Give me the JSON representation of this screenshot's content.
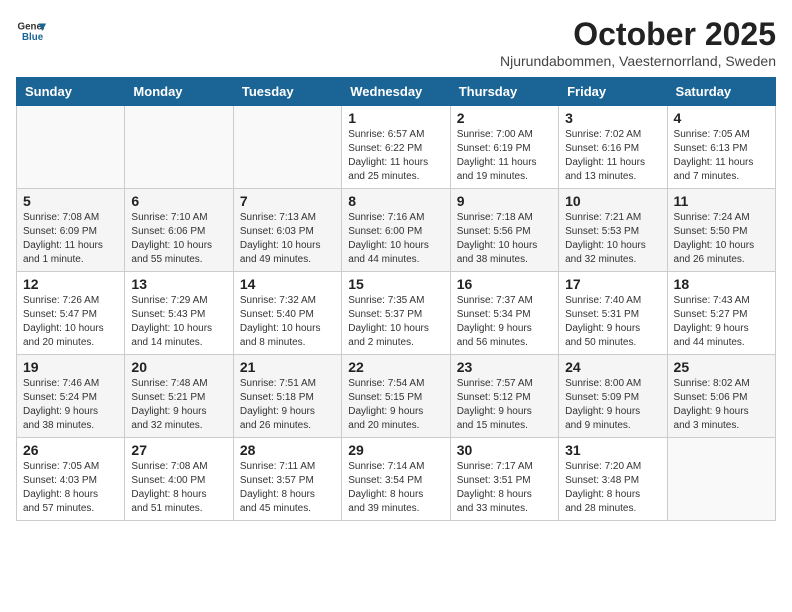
{
  "header": {
    "logo_line1": "General",
    "logo_line2": "Blue",
    "month_year": "October 2025",
    "location": "Njurundabommen, Vaesternorrland, Sweden"
  },
  "weekdays": [
    "Sunday",
    "Monday",
    "Tuesday",
    "Wednesday",
    "Thursday",
    "Friday",
    "Saturday"
  ],
  "weeks": [
    [
      {
        "day": "",
        "info": ""
      },
      {
        "day": "",
        "info": ""
      },
      {
        "day": "",
        "info": ""
      },
      {
        "day": "1",
        "info": "Sunrise: 6:57 AM\nSunset: 6:22 PM\nDaylight: 11 hours\nand 25 minutes."
      },
      {
        "day": "2",
        "info": "Sunrise: 7:00 AM\nSunset: 6:19 PM\nDaylight: 11 hours\nand 19 minutes."
      },
      {
        "day": "3",
        "info": "Sunrise: 7:02 AM\nSunset: 6:16 PM\nDaylight: 11 hours\nand 13 minutes."
      },
      {
        "day": "4",
        "info": "Sunrise: 7:05 AM\nSunset: 6:13 PM\nDaylight: 11 hours\nand 7 minutes."
      }
    ],
    [
      {
        "day": "5",
        "info": "Sunrise: 7:08 AM\nSunset: 6:09 PM\nDaylight: 11 hours\nand 1 minute."
      },
      {
        "day": "6",
        "info": "Sunrise: 7:10 AM\nSunset: 6:06 PM\nDaylight: 10 hours\nand 55 minutes."
      },
      {
        "day": "7",
        "info": "Sunrise: 7:13 AM\nSunset: 6:03 PM\nDaylight: 10 hours\nand 49 minutes."
      },
      {
        "day": "8",
        "info": "Sunrise: 7:16 AM\nSunset: 6:00 PM\nDaylight: 10 hours\nand 44 minutes."
      },
      {
        "day": "9",
        "info": "Sunrise: 7:18 AM\nSunset: 5:56 PM\nDaylight: 10 hours\nand 38 minutes."
      },
      {
        "day": "10",
        "info": "Sunrise: 7:21 AM\nSunset: 5:53 PM\nDaylight: 10 hours\nand 32 minutes."
      },
      {
        "day": "11",
        "info": "Sunrise: 7:24 AM\nSunset: 5:50 PM\nDaylight: 10 hours\nand 26 minutes."
      }
    ],
    [
      {
        "day": "12",
        "info": "Sunrise: 7:26 AM\nSunset: 5:47 PM\nDaylight: 10 hours\nand 20 minutes."
      },
      {
        "day": "13",
        "info": "Sunrise: 7:29 AM\nSunset: 5:43 PM\nDaylight: 10 hours\nand 14 minutes."
      },
      {
        "day": "14",
        "info": "Sunrise: 7:32 AM\nSunset: 5:40 PM\nDaylight: 10 hours\nand 8 minutes."
      },
      {
        "day": "15",
        "info": "Sunrise: 7:35 AM\nSunset: 5:37 PM\nDaylight: 10 hours\nand 2 minutes."
      },
      {
        "day": "16",
        "info": "Sunrise: 7:37 AM\nSunset: 5:34 PM\nDaylight: 9 hours\nand 56 minutes."
      },
      {
        "day": "17",
        "info": "Sunrise: 7:40 AM\nSunset: 5:31 PM\nDaylight: 9 hours\nand 50 minutes."
      },
      {
        "day": "18",
        "info": "Sunrise: 7:43 AM\nSunset: 5:27 PM\nDaylight: 9 hours\nand 44 minutes."
      }
    ],
    [
      {
        "day": "19",
        "info": "Sunrise: 7:46 AM\nSunset: 5:24 PM\nDaylight: 9 hours\nand 38 minutes."
      },
      {
        "day": "20",
        "info": "Sunrise: 7:48 AM\nSunset: 5:21 PM\nDaylight: 9 hours\nand 32 minutes."
      },
      {
        "day": "21",
        "info": "Sunrise: 7:51 AM\nSunset: 5:18 PM\nDaylight: 9 hours\nand 26 minutes."
      },
      {
        "day": "22",
        "info": "Sunrise: 7:54 AM\nSunset: 5:15 PM\nDaylight: 9 hours\nand 20 minutes."
      },
      {
        "day": "23",
        "info": "Sunrise: 7:57 AM\nSunset: 5:12 PM\nDaylight: 9 hours\nand 15 minutes."
      },
      {
        "day": "24",
        "info": "Sunrise: 8:00 AM\nSunset: 5:09 PM\nDaylight: 9 hours\nand 9 minutes."
      },
      {
        "day": "25",
        "info": "Sunrise: 8:02 AM\nSunset: 5:06 PM\nDaylight: 9 hours\nand 3 minutes."
      }
    ],
    [
      {
        "day": "26",
        "info": "Sunrise: 7:05 AM\nSunset: 4:03 PM\nDaylight: 8 hours\nand 57 minutes."
      },
      {
        "day": "27",
        "info": "Sunrise: 7:08 AM\nSunset: 4:00 PM\nDaylight: 8 hours\nand 51 minutes."
      },
      {
        "day": "28",
        "info": "Sunrise: 7:11 AM\nSunset: 3:57 PM\nDaylight: 8 hours\nand 45 minutes."
      },
      {
        "day": "29",
        "info": "Sunrise: 7:14 AM\nSunset: 3:54 PM\nDaylight: 8 hours\nand 39 minutes."
      },
      {
        "day": "30",
        "info": "Sunrise: 7:17 AM\nSunset: 3:51 PM\nDaylight: 8 hours\nand 33 minutes."
      },
      {
        "day": "31",
        "info": "Sunrise: 7:20 AM\nSunset: 3:48 PM\nDaylight: 8 hours\nand 28 minutes."
      },
      {
        "day": "",
        "info": ""
      }
    ]
  ]
}
